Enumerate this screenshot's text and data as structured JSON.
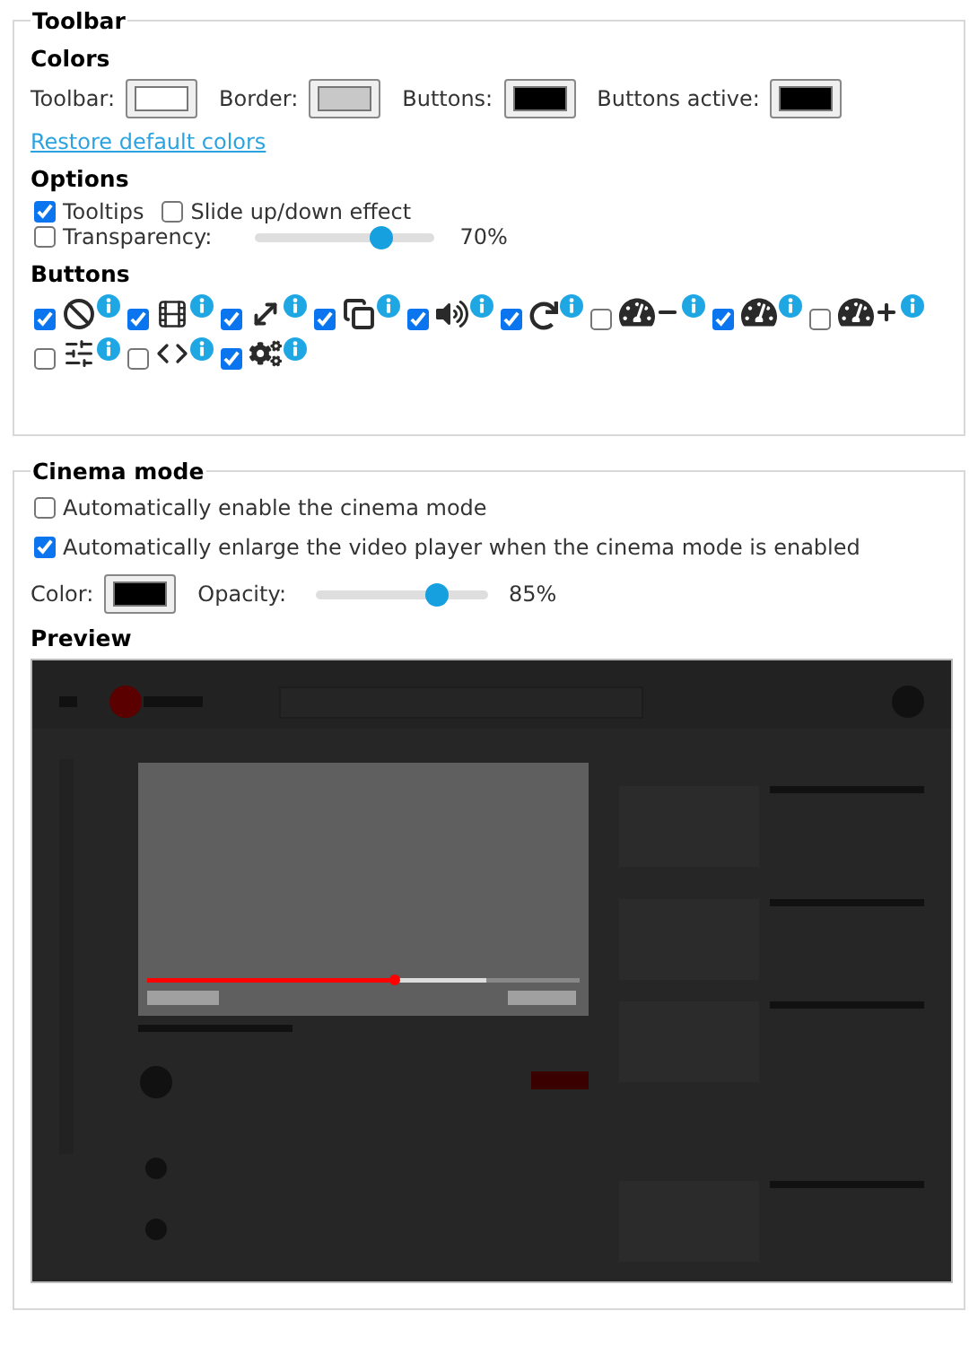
{
  "toolbar": {
    "legend": "Toolbar",
    "colors_heading": "Colors",
    "colors": [
      {
        "label": "Toolbar:",
        "color": "#ffffff"
      },
      {
        "label": "Border:",
        "color": "#c8c8c8"
      },
      {
        "label": "Buttons:",
        "color": "#000000"
      },
      {
        "label": "Buttons active:",
        "color": "#000000"
      }
    ],
    "restore_link": "Restore default colors",
    "options_heading": "Options",
    "options": [
      {
        "label": "Tooltips",
        "checked": true
      },
      {
        "label": "Slide up/down effect",
        "checked": false
      }
    ],
    "transparency": {
      "label": "Transparency:",
      "checked": false,
      "level": 0.7,
      "reading": "70%"
    },
    "buttons_heading": "Buttons",
    "buttons": [
      {
        "kind": "block",
        "checked": true
      },
      {
        "kind": "film",
        "checked": true
      },
      {
        "kind": "expand",
        "checked": true
      },
      {
        "kind": "copy",
        "checked": true
      },
      {
        "kind": "volume",
        "checked": true
      },
      {
        "kind": "reload",
        "checked": true
      },
      {
        "kind": "speed-minus",
        "checked": false
      },
      {
        "kind": "speed",
        "checked": true
      },
      {
        "kind": "speed-plus",
        "checked": false
      },
      {
        "kind": "sliders",
        "checked": false
      },
      {
        "kind": "code",
        "checked": false
      },
      {
        "kind": "gears",
        "checked": true
      }
    ]
  },
  "cinema_mode": {
    "legend": "Cinema mode",
    "options": [
      {
        "label": "Automatically enable the cinema mode",
        "checked": false
      },
      {
        "label": "Automatically enlarge the video player when the cinema mode is enabled",
        "checked": true
      }
    ],
    "color_label": "Color:",
    "color": "#000000",
    "opacity": {
      "label": "Opacity:",
      "level": 0.7,
      "reading": "85%"
    },
    "preview_heading": "Preview"
  }
}
